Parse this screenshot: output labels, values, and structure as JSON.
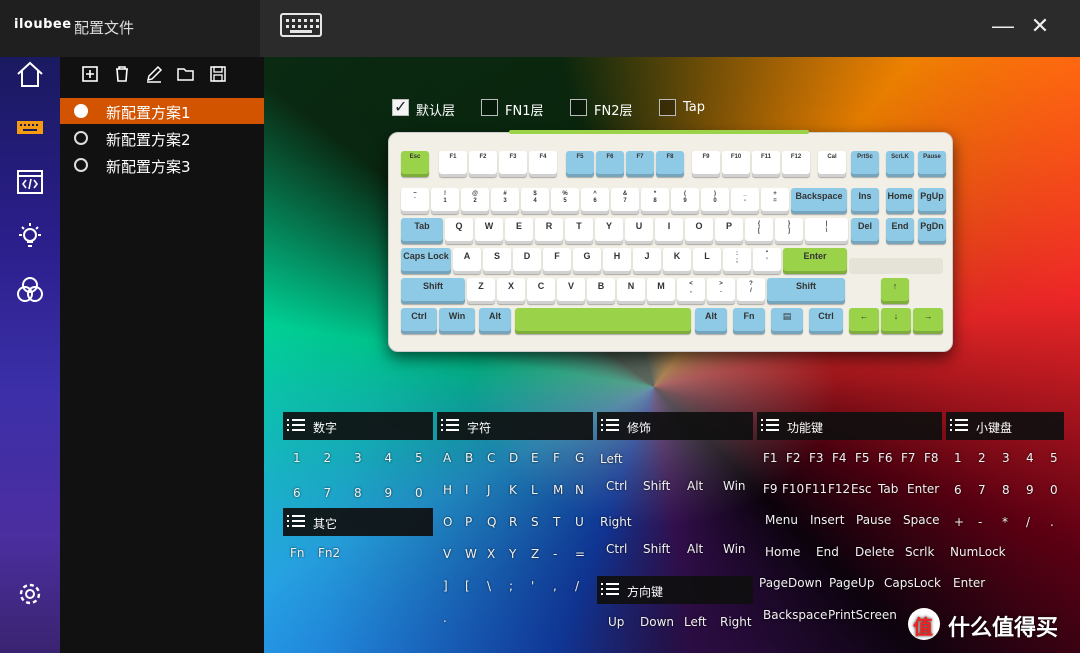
{
  "app": {
    "brand": "iloubee",
    "title": "配置文件"
  },
  "window": {
    "minimize": "—",
    "close": "✕"
  },
  "sidebar": [
    "home-icon",
    "keyboard-icon",
    "macro-icon",
    "light-icon",
    "color-icon",
    "settings-icon"
  ],
  "profiles": [
    {
      "label": "新配置方案1",
      "active": true
    },
    {
      "label": "新配置方案2",
      "active": false
    },
    {
      "label": "新配置方案3",
      "active": false
    }
  ],
  "layers": [
    {
      "label": "默认层",
      "checked": true
    },
    {
      "label": "FN1层",
      "checked": false
    },
    {
      "label": "FN2层",
      "checked": false
    },
    {
      "label": "Tap",
      "checked": false
    }
  ],
  "keyboard": {
    "fn_row": [
      "Esc",
      "F1",
      "F2",
      "F3",
      "F4",
      "F5",
      "F6",
      "F7",
      "F8",
      "F9",
      "F10",
      "F11",
      "F12",
      "Cal",
      "PrtSc",
      "ScrLK",
      "Pause"
    ],
    "num_row": [
      "~ `",
      "! 1",
      "@ 2",
      "# 3",
      "$ 4",
      "% 5",
      "^ 6",
      "& 7",
      "* 8",
      "( 9",
      ") 0",
      "_ -",
      "+ =",
      "Backspace",
      "Ins",
      "Home",
      "PgUp"
    ],
    "tab_row": [
      "Tab",
      "Q",
      "W",
      "E",
      "R",
      "T",
      "Y",
      "U",
      "I",
      "O",
      "P",
      "{ [",
      "} ]",
      "| \\",
      "Del",
      "End",
      "PgDn"
    ],
    "caps_row": [
      "Caps Lock",
      "A",
      "S",
      "D",
      "F",
      "G",
      "H",
      "J",
      "K",
      "L",
      ": ;",
      "\" '",
      "Enter"
    ],
    "shift_row": [
      "Shift",
      "Z",
      "X",
      "C",
      "V",
      "B",
      "N",
      "M",
      "< ,",
      "> .",
      "? /",
      "Shift",
      "↑"
    ],
    "ctrl_row": [
      "Ctrl",
      "Win",
      "Alt",
      "",
      "Alt",
      "Fn",
      "▤",
      "Ctrl",
      "←",
      "↓",
      "→"
    ]
  },
  "categories": {
    "digits": {
      "title": "数字",
      "items": [
        "1",
        "2",
        "3",
        "4",
        "5",
        "6",
        "7",
        "8",
        "9",
        "0"
      ]
    },
    "other": {
      "title": "其它",
      "items": [
        "Fn",
        "Fn2"
      ]
    },
    "chars": {
      "title": "字符",
      "items": [
        "A",
        "B",
        "C",
        "D",
        "E",
        "F",
        "G",
        "H",
        "I",
        "J",
        "K",
        "L",
        "M",
        "N",
        "O",
        "P",
        "Q",
        "R",
        "S",
        "T",
        "U",
        "V",
        "W",
        "X",
        "Y",
        "Z",
        "-",
        "=",
        "]",
        "[",
        "\\",
        ";",
        "'",
        ",",
        "/",
        "."
      ]
    },
    "modifiers": {
      "title": "修饰",
      "left": "Left",
      "right": "Right",
      "left_items": [
        "Ctrl",
        "Shift",
        "Alt",
        "Win"
      ],
      "right_items": [
        "Ctrl",
        "Shift",
        "Alt",
        "Win"
      ]
    },
    "arrows": {
      "title": "方向键",
      "items": [
        "Up",
        "Down",
        "Left",
        "Right"
      ]
    },
    "function": {
      "title": "功能键",
      "items": [
        "F1",
        "F2",
        "F3",
        "F4",
        "F5",
        "F6",
        "F7",
        "F8",
        "F9",
        "F10",
        "F11",
        "F12",
        "Esc",
        "Tab",
        "Enter",
        "Menu",
        "Insert",
        "Pause",
        "Space",
        "Home",
        "End",
        "Delete",
        "Scrlk",
        "NumLock",
        "PageDown",
        "PageUp",
        "CapsLock",
        "Enter",
        "Backspace",
        "PrintScreen"
      ]
    },
    "numpad": {
      "title": "小键盘",
      "items": [
        "1",
        "2",
        "3",
        "4",
        "5",
        "6",
        "7",
        "8",
        "9",
        "0",
        "+",
        "-",
        "*",
        "/",
        "."
      ]
    }
  },
  "watermark": "什么值得买"
}
